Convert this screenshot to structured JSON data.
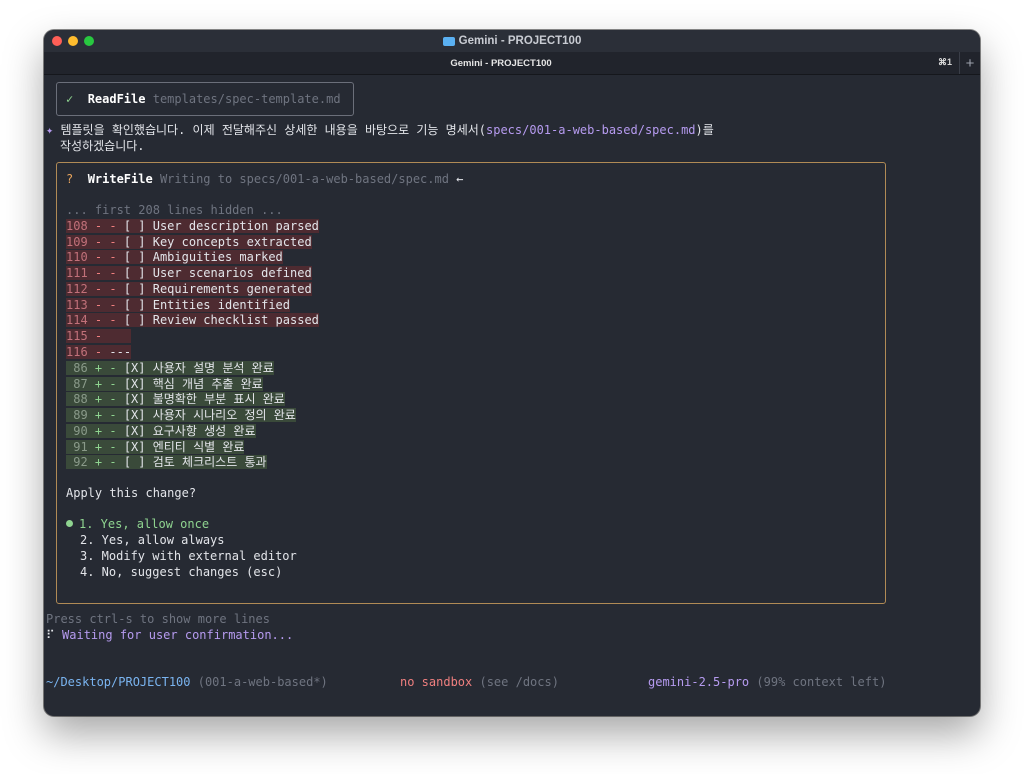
{
  "window": {
    "title": "Gemini - PROJECT100",
    "tab_label": "Gemini - PROJECT100",
    "tab_shortcut": "⌘1",
    "new_tab": "+"
  },
  "readfile": {
    "check": "✓",
    "tool": "ReadFile",
    "path": "templates/spec-template.md"
  },
  "message": {
    "bullet": "✦",
    "line1_prefix": "템플릿을 확인했습니다. 이제 전달해주신 상세한 내용을 바탕으로 기능 명세서(",
    "line1_link": "specs/001-a-web-based/spec.md",
    "line1_suffix": ")를",
    "line2": "작성하겠습니다."
  },
  "writefile": {
    "marker": "?",
    "tool": "WriteFile",
    "description": "Writing to specs/001-a-web-based/spec.md",
    "arrow": "←",
    "hidden_note": "... first 208 lines hidden ...",
    "removed_lines": [
      {
        "num": "108",
        "sign": "-",
        "text": "- [ ] User description parsed"
      },
      {
        "num": "109",
        "sign": "-",
        "text": "- [ ] Key concepts extracted"
      },
      {
        "num": "110",
        "sign": "-",
        "text": "- [ ] Ambiguities marked"
      },
      {
        "num": "111",
        "sign": "-",
        "text": "- [ ] User scenarios defined"
      },
      {
        "num": "112",
        "sign": "-",
        "text": "- [ ] Requirements generated"
      },
      {
        "num": "113",
        "sign": "-",
        "text": "- [ ] Entities identified"
      },
      {
        "num": "114",
        "sign": "-",
        "text": "- [ ] Review checklist passed"
      },
      {
        "num": "115",
        "sign": "-",
        "text": "   "
      },
      {
        "num": "116",
        "sign": "-",
        "text": "---"
      }
    ],
    "added_lines": [
      {
        "num": "86",
        "sign": "+",
        "text": "- [X] 사용자 설명 분석 완료"
      },
      {
        "num": "87",
        "sign": "+",
        "text": "- [X] 핵심 개념 추출 완료"
      },
      {
        "num": "88",
        "sign": "+",
        "text": "- [X] 불명확한 부분 표시 완료"
      },
      {
        "num": "89",
        "sign": "+",
        "text": "- [X] 사용자 시나리오 정의 완료"
      },
      {
        "num": "90",
        "sign": "+",
        "text": "- [X] 요구사항 생성 완료"
      },
      {
        "num": "91",
        "sign": "+",
        "text": "- [X] 엔티티 식별 완료"
      },
      {
        "num": "92",
        "sign": "+",
        "text": "- [ ] 검토 체크리스트 통과"
      }
    ],
    "question": "Apply this change?",
    "options": [
      "1. Yes, allow once",
      "2. Yes, allow always",
      "3. Modify with external editor",
      "4. No, suggest changes (esc)"
    ]
  },
  "footer": {
    "more_lines": "Press ctrl-s to show more lines",
    "spinner": "⠏",
    "waiting": "Waiting for user confirmation..."
  },
  "statusbar": {
    "path": "~/Desktop/PROJECT100",
    "branch": "(001-a-web-based*)",
    "sandbox": "no sandbox",
    "sandbox_hint": "(see /docs)",
    "model": "gemini-2.5-pro",
    "context": "(99% context left)"
  },
  "colors": {
    "accent_purple": "#b69bf0",
    "accent_green": "#8fd490",
    "diff_removed_bg": "#4e2b31",
    "diff_added_bg": "#3a4a3a",
    "path_blue": "#7ab4f0",
    "warning_red": "#ef7f7f",
    "writefile_border": "#b08a55"
  }
}
